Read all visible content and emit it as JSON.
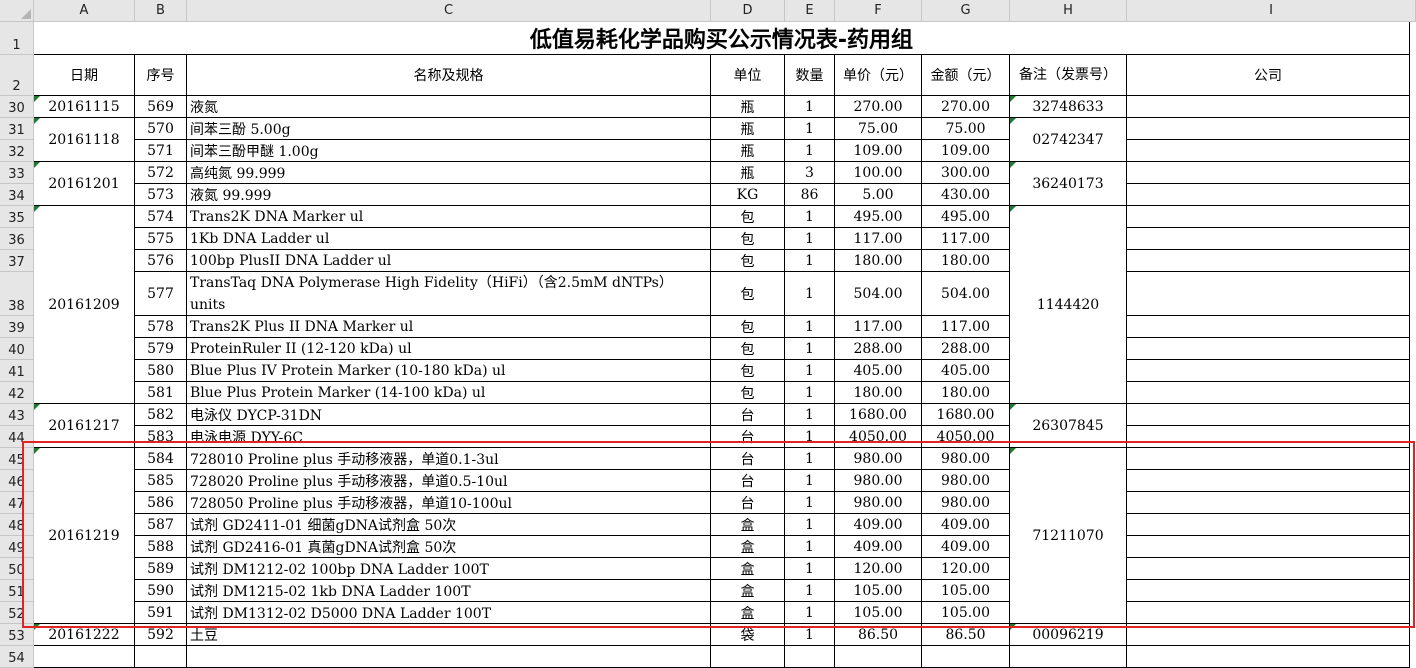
{
  "sheet": {
    "title": "低值易耗化学品购买公示情况表-药用组",
    "columns": [
      "A",
      "B",
      "C",
      "D",
      "E",
      "F",
      "G",
      "H",
      "I"
    ],
    "headers": {
      "date": "日期",
      "seq": "序号",
      "name": "名称及规格",
      "unit": "单位",
      "qty": "数量",
      "price": "单价（元）",
      "amount": "金额（元）",
      "note": "备注（发票号）",
      "company": "公司"
    },
    "row_numbers": [
      "1",
      "2",
      "30",
      "31",
      "32",
      "33",
      "34",
      "35",
      "36",
      "37",
      "38",
      "39",
      "40",
      "41",
      "42",
      "43",
      "44",
      "45",
      "46",
      "47",
      "48",
      "49",
      "50",
      "51",
      "52",
      "53",
      "54"
    ],
    "date_groups": [
      {
        "date": "20161115",
        "invoice": "32748633"
      },
      {
        "date": "20161118",
        "invoice": "02742347"
      },
      {
        "date": "20161201",
        "invoice": "36240173"
      },
      {
        "date": "20161209",
        "invoice": "1144420"
      },
      {
        "date": "20161217",
        "invoice": "26307845"
      },
      {
        "date": "20161219",
        "invoice": "71211070"
      },
      {
        "date": "20161222",
        "invoice": "00096219"
      }
    ],
    "rows": [
      {
        "seq": "569",
        "name": "液氮",
        "unit": "瓶",
        "qty": "1",
        "price": "270.00",
        "amount": "270.00"
      },
      {
        "seq": "570",
        "name": "间苯三酚  5.00g",
        "unit": "瓶",
        "qty": "1",
        "price": "75.00",
        "amount": "75.00"
      },
      {
        "seq": "571",
        "name": "间苯三酚甲醚  1.00g",
        "unit": "瓶",
        "qty": "1",
        "price": "109.00",
        "amount": "109.00"
      },
      {
        "seq": "572",
        "name": "高纯氮  99.999",
        "unit": "瓶",
        "qty": "3",
        "price": "100.00",
        "amount": "300.00"
      },
      {
        "seq": "573",
        "name": "液氮   99.999",
        "unit": "KG",
        "qty": "86",
        "price": "5.00",
        "amount": "430.00"
      },
      {
        "seq": "574",
        "name": "Trans2K DNA Marker    ul",
        "unit": "包",
        "qty": "1",
        "price": "495.00",
        "amount": "495.00"
      },
      {
        "seq": "575",
        "name": "1Kb DNA Ladder   ul",
        "unit": "包",
        "qty": "1",
        "price": "117.00",
        "amount": "117.00"
      },
      {
        "seq": "576",
        "name": "100bp PlusII DNA Ladder   ul",
        "unit": "包",
        "qty": "1",
        "price": "180.00",
        "amount": "180.00"
      },
      {
        "seq": "577",
        "name": "TransTaq DNA Polymerase High Fidelity（HiFi）（含2.5mM dNTPs） units",
        "unit": "包",
        "qty": "1",
        "price": "504.00",
        "amount": "504.00"
      },
      {
        "seq": "578",
        "name": "Trans2K Plus II DNA Marker   ul",
        "unit": "包",
        "qty": "1",
        "price": "117.00",
        "amount": "117.00"
      },
      {
        "seq": "579",
        "name": "ProteinRuler II (12-120 kDa)  ul",
        "unit": "包",
        "qty": "1",
        "price": "288.00",
        "amount": "288.00"
      },
      {
        "seq": "580",
        "name": "Blue Plus IV Protein Marker (10-180 kDa)  ul",
        "unit": "包",
        "qty": "1",
        "price": "405.00",
        "amount": "405.00"
      },
      {
        "seq": "581",
        "name": "Blue Plus Protein Marker (14-100 kDa)  ul",
        "unit": "包",
        "qty": "1",
        "price": "180.00",
        "amount": "180.00"
      },
      {
        "seq": "582",
        "name": "电泳仪     DYCP-31DN",
        "unit": "台",
        "qty": "1",
        "price": "1680.00",
        "amount": "1680.00"
      },
      {
        "seq": "583",
        "name": "电泳电源      DYY-6C",
        "unit": "台",
        "qty": "1",
        "price": "4050.00",
        "amount": "4050.00"
      },
      {
        "seq": "584",
        "name": "728010 Proline plus 手动移液器，单道0.1-3ul",
        "unit": "台",
        "qty": "1",
        "price": "980.00",
        "amount": "980.00"
      },
      {
        "seq": "585",
        "name": "728020 Proline plus 手动移液器，单道0.5-10ul",
        "unit": "台",
        "qty": "1",
        "price": "980.00",
        "amount": "980.00"
      },
      {
        "seq": "586",
        "name": "728050 Proline plus 手动移液器，单道10-100ul",
        "unit": "台",
        "qty": "1",
        "price": "980.00",
        "amount": "980.00"
      },
      {
        "seq": "587",
        "name": "试剂 GD2411-01 细菌gDNA试剂盒      50次",
        "unit": "盒",
        "qty": "1",
        "price": "409.00",
        "amount": "409.00"
      },
      {
        "seq": "588",
        "name": "试剂 GD2416-01 真菌gDNA试剂盒      50次",
        "unit": "盒",
        "qty": "1",
        "price": "409.00",
        "amount": "409.00"
      },
      {
        "seq": "589",
        "name": "试剂 DM1212-02 100bp DNA Ladder   100T",
        "unit": "盒",
        "qty": "1",
        "price": "120.00",
        "amount": "120.00"
      },
      {
        "seq": "590",
        "name": "试剂 DM1215-02 1kb DNA Ladder   100T",
        "unit": "盒",
        "qty": "1",
        "price": "105.00",
        "amount": "105.00"
      },
      {
        "seq": "591",
        "name": "试剂 DM1312-02 D5000 DNA Ladder   100T",
        "unit": "盒",
        "qty": "1",
        "price": "105.00",
        "amount": "105.00"
      },
      {
        "seq": "592",
        "name": "土豆",
        "unit": "袋",
        "qty": "1",
        "price": "86.50",
        "amount": "86.50"
      }
    ]
  }
}
